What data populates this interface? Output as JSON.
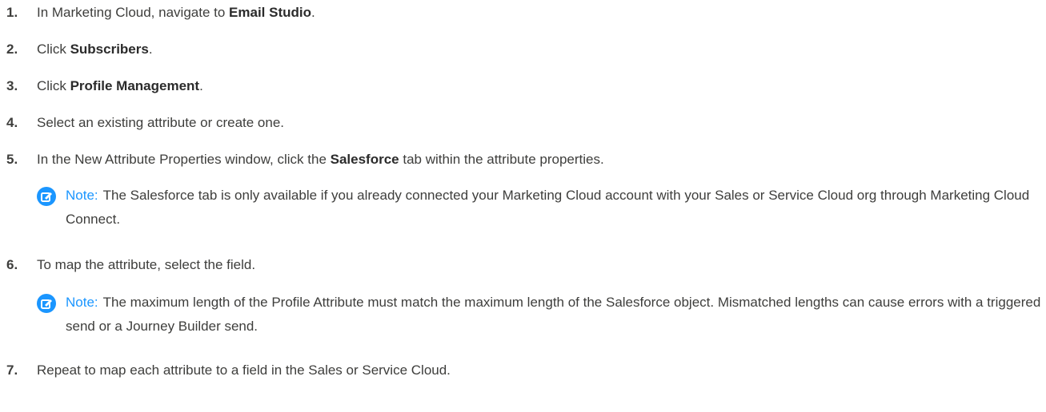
{
  "steps": [
    {
      "num": "1.",
      "pre": "In Marketing Cloud, navigate to ",
      "bold": "Email Studio",
      "post": "."
    },
    {
      "num": "2.",
      "pre": "Click ",
      "bold": "Subscribers",
      "post": "."
    },
    {
      "num": "3.",
      "pre": "Click ",
      "bold": "Profile Management",
      "post": "."
    },
    {
      "num": "4.",
      "pre": "Select an existing attribute or create one.",
      "bold": "",
      "post": ""
    },
    {
      "num": "5.",
      "pre": "In the New Attribute Properties window, click the ",
      "bold": "Salesforce",
      "post": " tab within the attribute properties."
    },
    {
      "num": "6.",
      "pre": "To map the attribute, select the field.",
      "bold": "",
      "post": ""
    },
    {
      "num": "7.",
      "pre": "Repeat to map each attribute to a field in the Sales or Service Cloud.",
      "bold": "",
      "post": ""
    }
  ],
  "notes": [
    {
      "label": "Note:",
      "text": "The Salesforce tab is only available if you already connected your Marketing Cloud account with your Sales or Service Cloud org through Marketing Cloud Connect."
    },
    {
      "label": "Note:",
      "text": "The maximum length of the Profile Attribute must match the maximum length of the Salesforce object. Mismatched lengths can cause errors with a triggered send or a Journey Builder send."
    }
  ],
  "icons": {
    "note": "edit-note-icon"
  },
  "colors": {
    "accent": "#1b96ff",
    "text": "#3e3e3c"
  }
}
